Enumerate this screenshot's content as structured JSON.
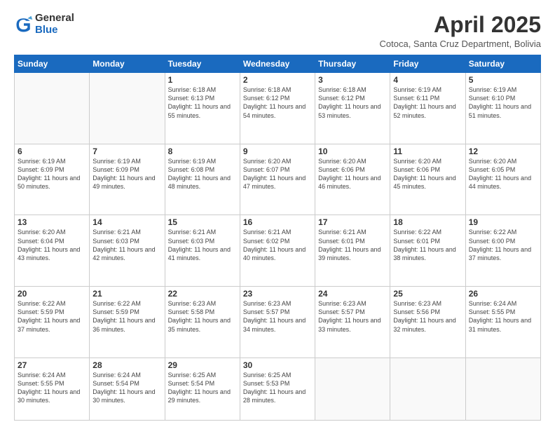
{
  "header": {
    "logo_general": "General",
    "logo_blue": "Blue",
    "month_title": "April 2025",
    "subtitle": "Cotoca, Santa Cruz Department, Bolivia"
  },
  "days_of_week": [
    "Sunday",
    "Monday",
    "Tuesday",
    "Wednesday",
    "Thursday",
    "Friday",
    "Saturday"
  ],
  "weeks": [
    [
      {
        "num": "",
        "info": ""
      },
      {
        "num": "",
        "info": ""
      },
      {
        "num": "1",
        "info": "Sunrise: 6:18 AM\nSunset: 6:13 PM\nDaylight: 11 hours and 55 minutes."
      },
      {
        "num": "2",
        "info": "Sunrise: 6:18 AM\nSunset: 6:12 PM\nDaylight: 11 hours and 54 minutes."
      },
      {
        "num": "3",
        "info": "Sunrise: 6:18 AM\nSunset: 6:12 PM\nDaylight: 11 hours and 53 minutes."
      },
      {
        "num": "4",
        "info": "Sunrise: 6:19 AM\nSunset: 6:11 PM\nDaylight: 11 hours and 52 minutes."
      },
      {
        "num": "5",
        "info": "Sunrise: 6:19 AM\nSunset: 6:10 PM\nDaylight: 11 hours and 51 minutes."
      }
    ],
    [
      {
        "num": "6",
        "info": "Sunrise: 6:19 AM\nSunset: 6:09 PM\nDaylight: 11 hours and 50 minutes."
      },
      {
        "num": "7",
        "info": "Sunrise: 6:19 AM\nSunset: 6:09 PM\nDaylight: 11 hours and 49 minutes."
      },
      {
        "num": "8",
        "info": "Sunrise: 6:19 AM\nSunset: 6:08 PM\nDaylight: 11 hours and 48 minutes."
      },
      {
        "num": "9",
        "info": "Sunrise: 6:20 AM\nSunset: 6:07 PM\nDaylight: 11 hours and 47 minutes."
      },
      {
        "num": "10",
        "info": "Sunrise: 6:20 AM\nSunset: 6:06 PM\nDaylight: 11 hours and 46 minutes."
      },
      {
        "num": "11",
        "info": "Sunrise: 6:20 AM\nSunset: 6:06 PM\nDaylight: 11 hours and 45 minutes."
      },
      {
        "num": "12",
        "info": "Sunrise: 6:20 AM\nSunset: 6:05 PM\nDaylight: 11 hours and 44 minutes."
      }
    ],
    [
      {
        "num": "13",
        "info": "Sunrise: 6:20 AM\nSunset: 6:04 PM\nDaylight: 11 hours and 43 minutes."
      },
      {
        "num": "14",
        "info": "Sunrise: 6:21 AM\nSunset: 6:03 PM\nDaylight: 11 hours and 42 minutes."
      },
      {
        "num": "15",
        "info": "Sunrise: 6:21 AM\nSunset: 6:03 PM\nDaylight: 11 hours and 41 minutes."
      },
      {
        "num": "16",
        "info": "Sunrise: 6:21 AM\nSunset: 6:02 PM\nDaylight: 11 hours and 40 minutes."
      },
      {
        "num": "17",
        "info": "Sunrise: 6:21 AM\nSunset: 6:01 PM\nDaylight: 11 hours and 39 minutes."
      },
      {
        "num": "18",
        "info": "Sunrise: 6:22 AM\nSunset: 6:01 PM\nDaylight: 11 hours and 38 minutes."
      },
      {
        "num": "19",
        "info": "Sunrise: 6:22 AM\nSunset: 6:00 PM\nDaylight: 11 hours and 37 minutes."
      }
    ],
    [
      {
        "num": "20",
        "info": "Sunrise: 6:22 AM\nSunset: 5:59 PM\nDaylight: 11 hours and 37 minutes."
      },
      {
        "num": "21",
        "info": "Sunrise: 6:22 AM\nSunset: 5:59 PM\nDaylight: 11 hours and 36 minutes."
      },
      {
        "num": "22",
        "info": "Sunrise: 6:23 AM\nSunset: 5:58 PM\nDaylight: 11 hours and 35 minutes."
      },
      {
        "num": "23",
        "info": "Sunrise: 6:23 AM\nSunset: 5:57 PM\nDaylight: 11 hours and 34 minutes."
      },
      {
        "num": "24",
        "info": "Sunrise: 6:23 AM\nSunset: 5:57 PM\nDaylight: 11 hours and 33 minutes."
      },
      {
        "num": "25",
        "info": "Sunrise: 6:23 AM\nSunset: 5:56 PM\nDaylight: 11 hours and 32 minutes."
      },
      {
        "num": "26",
        "info": "Sunrise: 6:24 AM\nSunset: 5:55 PM\nDaylight: 11 hours and 31 minutes."
      }
    ],
    [
      {
        "num": "27",
        "info": "Sunrise: 6:24 AM\nSunset: 5:55 PM\nDaylight: 11 hours and 30 minutes."
      },
      {
        "num": "28",
        "info": "Sunrise: 6:24 AM\nSunset: 5:54 PM\nDaylight: 11 hours and 30 minutes."
      },
      {
        "num": "29",
        "info": "Sunrise: 6:25 AM\nSunset: 5:54 PM\nDaylight: 11 hours and 29 minutes."
      },
      {
        "num": "30",
        "info": "Sunrise: 6:25 AM\nSunset: 5:53 PM\nDaylight: 11 hours and 28 minutes."
      },
      {
        "num": "",
        "info": ""
      },
      {
        "num": "",
        "info": ""
      },
      {
        "num": "",
        "info": ""
      }
    ]
  ]
}
